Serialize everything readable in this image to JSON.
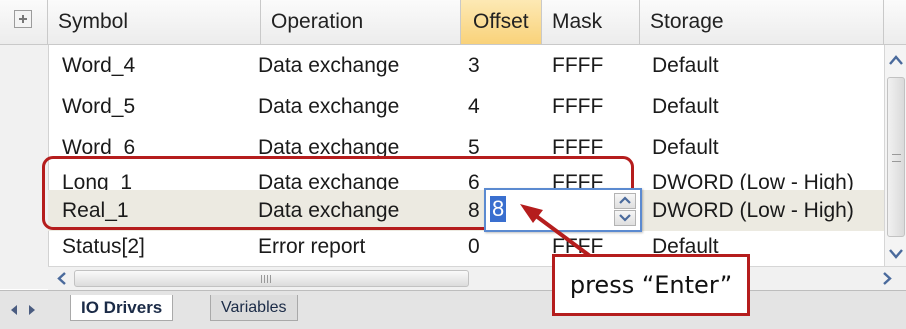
{
  "columns": {
    "symbol": "Symbol",
    "operation": "Operation",
    "offset": "Offset",
    "mask": "Mask",
    "storage": "Storage"
  },
  "rows": [
    {
      "symbol": "Word_4",
      "operation": "Data exchange",
      "offset": "3",
      "mask": "FFFF",
      "storage": "Default"
    },
    {
      "symbol": "Word_5",
      "operation": "Data exchange",
      "offset": "4",
      "mask": "FFFF",
      "storage": "Default"
    },
    {
      "symbol": "Word_6",
      "operation": "Data exchange",
      "offset": "5",
      "mask": "FFFF",
      "storage": "Default"
    },
    {
      "symbol": "Long_1",
      "operation": "Data exchange",
      "offset": "6",
      "mask": "FFFF",
      "storage": "DWORD (Low - High)"
    },
    {
      "symbol": "Real_1",
      "operation": "Data exchange",
      "offset": "8",
      "mask": "",
      "storage": "DWORD (Low - High)"
    },
    {
      "symbol": "Status[2]",
      "operation": "Error report",
      "offset": "0",
      "mask": "FFFF",
      "storage": "Default"
    }
  ],
  "editor": {
    "value": "8"
  },
  "tabs": {
    "active": "IO Drivers",
    "inactive": "Variables"
  },
  "callout": {
    "text": "press “Enter”"
  },
  "colors": {
    "highlight": "#b51d1d",
    "selected_row": "#eceae1",
    "sorted_header": "#f9d27a",
    "editor_selection": "#3a6fcf"
  },
  "icons": [
    "expand-icon",
    "scroll-up-icon",
    "scroll-down-icon",
    "scroll-left-icon",
    "scroll-right-icon",
    "tab-prev-icon",
    "tab-next-icon"
  ]
}
